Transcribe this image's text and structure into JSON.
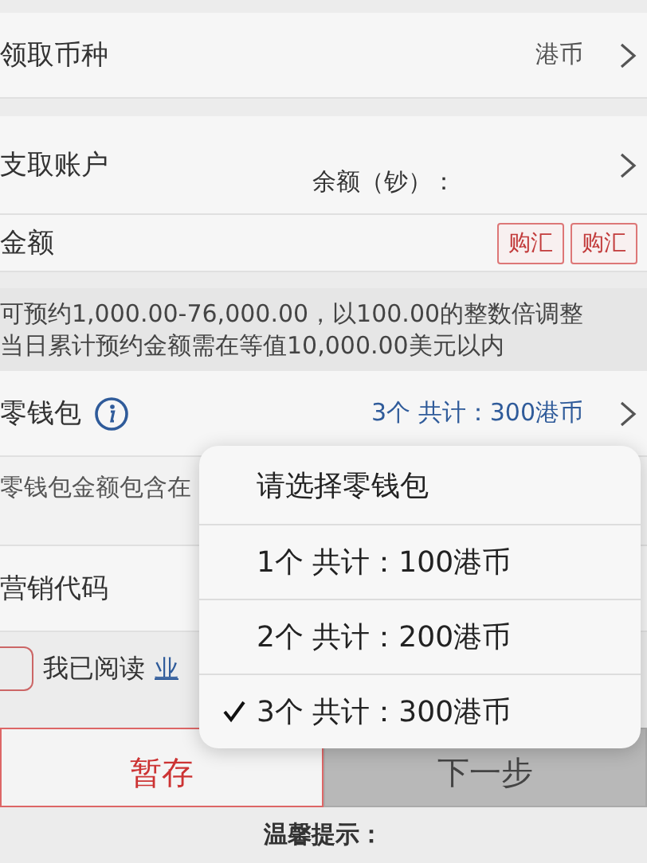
{
  "currency_row": {
    "label": "领取币种",
    "value": "港币"
  },
  "account_row": {
    "label": "支取账户",
    "balance_label": "余额（钞）："
  },
  "amount_row": {
    "label": "金额",
    "tags": [
      "购汇",
      "购汇"
    ]
  },
  "hint": [
    "可预约1,000.00-76,000.00，以100.00的整数倍调整",
    "当日累计预约金额需在等值10,000.00美元以内"
  ],
  "wallet_row": {
    "label": "零钱包",
    "value": "3个  共计：300港币"
  },
  "wallet_note": "零钱包金额包含在",
  "marketing_row": {
    "label": "营销代码"
  },
  "agreement": {
    "checked": false,
    "text": "我已阅读",
    "link": "业"
  },
  "buttons": [
    {
      "label": "暂存",
      "kind": "secondary"
    },
    {
      "label": "下一步",
      "kind": "primary"
    }
  ],
  "tip_title": "温馨提示：",
  "wallet_menu": {
    "title": "请选择零钱包",
    "options": [
      {
        "label": "1个  共计：100港币",
        "selected": false
      },
      {
        "label": "2个  共计：200港币",
        "selected": false
      },
      {
        "label": "3个  共计：300港币",
        "selected": true
      }
    ]
  }
}
